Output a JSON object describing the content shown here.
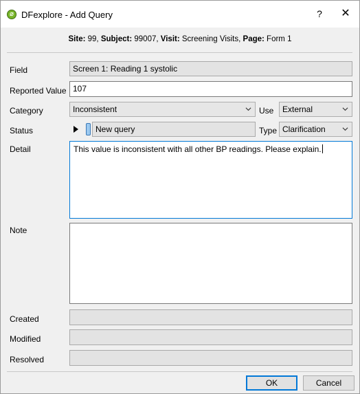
{
  "window": {
    "title": "DFexplore - Add Query",
    "app_icon_glyph": "⌀",
    "help_label": "?",
    "close_label": "✕"
  },
  "header": {
    "site_label": "Site:",
    "site_value": " 99, ",
    "subject_label": "Subject:",
    "subject_value": " 99007, ",
    "visit_label": "Visit:",
    "visit_value": " Screening Visits, ",
    "page_label": "Page:",
    "page_value": " Form 1"
  },
  "form": {
    "field_label": "Field",
    "field_value": "Screen 1: Reading 1 systolic",
    "reported_label": "Reported Value",
    "reported_value": "107",
    "category_label": "Category",
    "category_value": "Inconsistent",
    "use_label": "Use",
    "use_value": "External",
    "status_label": "Status",
    "status_value": "New query",
    "type_label": "Type",
    "type_value": "Clarification",
    "detail_label": "Detail",
    "detail_value": "This value is inconsistent with all other BP readings. Please explain.",
    "note_label": "Note",
    "note_value": "",
    "created_label": "Created",
    "created_value": "",
    "modified_label": "Modified",
    "modified_value": "",
    "resolved_label": "Resolved",
    "resolved_value": ""
  },
  "buttons": {
    "ok_label": "OK",
    "cancel_label": "Cancel"
  },
  "icons": {
    "app": "dfexplore-app-icon",
    "play": "play-icon",
    "status_flag": "status-flag-icon",
    "chevron": "chevron-down-icon"
  }
}
